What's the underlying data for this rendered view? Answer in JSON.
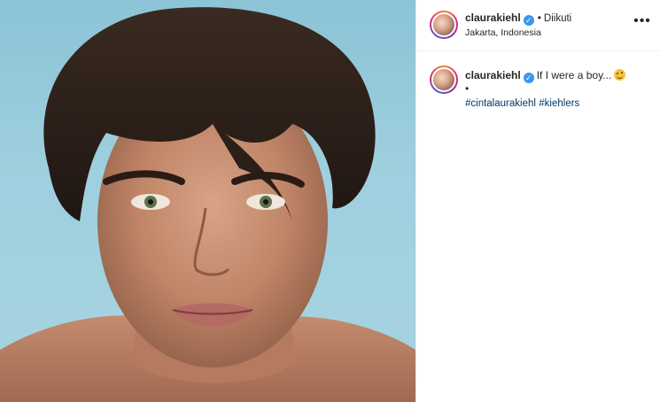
{
  "post": {
    "header": {
      "username": "claurakiehl",
      "separator": "•",
      "follow_state": "Diikuti",
      "location": "Jakarta, Indonesia",
      "more_label": "•••"
    },
    "caption": {
      "username": "claurakiehl",
      "text": "If I were a boy...",
      "emoji": "winking-tongue-emoji",
      "bullet": "•",
      "hashtags": [
        "#cintalaurakiehl",
        "#kiehlers"
      ]
    },
    "photo": {
      "subject": "portrait-photo",
      "background_color": "#9fd0df"
    },
    "colors": {
      "verified": "#3897f0",
      "hashtag": "#00376b",
      "text": "#262626",
      "divider": "#efefef"
    },
    "icons": {
      "verified": "verified-badge-icon",
      "more": "more-options-icon"
    }
  }
}
